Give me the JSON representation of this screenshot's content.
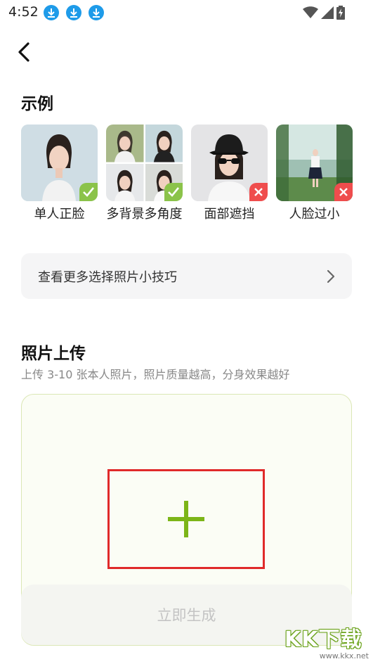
{
  "status_bar": {
    "time": "4:52",
    "icons": [
      "download-icon",
      "download-icon",
      "download-icon",
      "wifi-icon",
      "signal-icon",
      "battery-charging-icon"
    ]
  },
  "header": {
    "back_icon": "back-arrow-icon"
  },
  "examples": {
    "title": "示例",
    "items": [
      {
        "label": "单人正脸",
        "status": "check",
        "thumb": "single-front-face-photo"
      },
      {
        "label": "多背景多角度",
        "status": "check",
        "thumb": "multi-background-angles-collage"
      },
      {
        "label": "面部遮挡",
        "status": "cross",
        "thumb": "face-obstructed-hat-sunglasses-photo"
      },
      {
        "label": "人脸过小",
        "status": "cross",
        "thumb": "face-too-small-outdoor-photo"
      }
    ]
  },
  "tips": {
    "label": "查看更多选择照片小技巧",
    "icon": "chevron-right-icon"
  },
  "upload": {
    "title": "照片上传",
    "subtitle": "上传 3-10 张本人照片，照片质量越高，分身效果越好",
    "add_icon": "plus-icon",
    "generate_label": "立即生成"
  },
  "watermark": {
    "logo": "KK下载",
    "url": "www.kkx.net"
  },
  "colors": {
    "accent_green": "#7cb518",
    "ok_badge": "#8bc34a",
    "bad_badge": "#ef4d4d",
    "highlight_border": "#e02a2a",
    "download_icon_blue": "#1e9be9"
  }
}
